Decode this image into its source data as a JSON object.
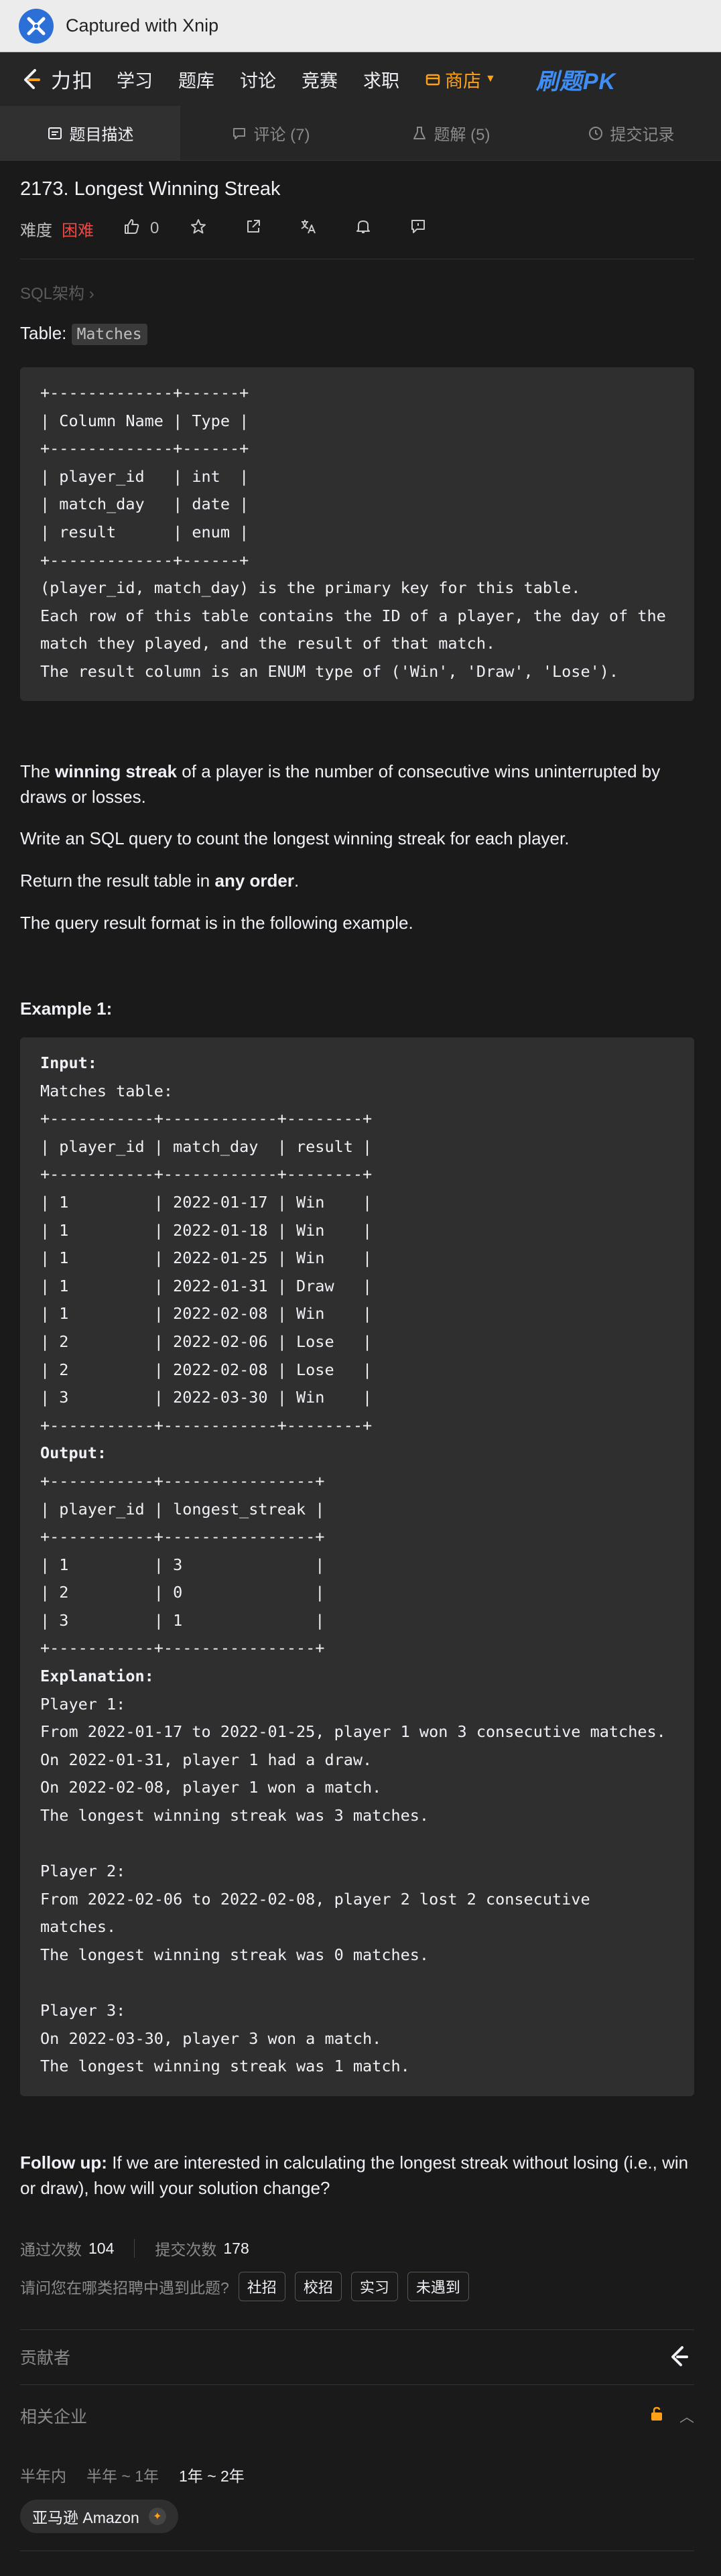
{
  "capture": {
    "title": "Captured with Xnip"
  },
  "nav": {
    "brand": "力扣",
    "items": [
      "学习",
      "题库",
      "讨论",
      "竞赛",
      "求职"
    ],
    "shop": "商店",
    "pk": "刷题PK"
  },
  "tabs": [
    {
      "label": "题目描述"
    },
    {
      "label": "评论 (7)"
    },
    {
      "label": "题解 (5)"
    },
    {
      "label": "提交记录"
    }
  ],
  "problem": {
    "title": "2173. Longest Winning Streak",
    "difficulty_label": "难度",
    "difficulty": "困难",
    "likes": "0",
    "breadcrumb": "SQL架构 ›",
    "table_label": "Table: ",
    "table_name": "Matches",
    "schema": "+-------------+------+\n| Column Name | Type |\n+-------------+------+\n| player_id   | int  |\n| match_day   | date |\n| result      | enum |\n+-------------+------+\n(player_id, match_day) is the primary key for this table.\nEach row of this table contains the ID of a player, the day of the\nmatch they played, and the result of that match.\nThe result column is an ENUM type of ('Win', 'Draw', 'Lose').",
    "desc_pre": "The ",
    "desc_bold": "winning streak",
    "desc_post": " of a player is the number of consecutive wins uninterrupted by draws or losses.",
    "query": "Write an SQL query to count the longest winning streak for each player.",
    "order_pre": "Return the result table in ",
    "order_bold": "any order",
    "order_post": ".",
    "format": "The query result format is in the following example.",
    "example_title": "Example 1:",
    "input_label": "Input:",
    "example_input": "Matches table:\n+-----------+------------+--------+\n| player_id | match_day  | result |\n+-----------+------------+--------+\n| 1         | 2022-01-17 | Win    |\n| 1         | 2022-01-18 | Win    |\n| 1         | 2022-01-25 | Win    |\n| 1         | 2022-01-31 | Draw   |\n| 1         | 2022-02-08 | Win    |\n| 2         | 2022-02-06 | Lose   |\n| 2         | 2022-02-08 | Lose   |\n| 3         | 2022-03-30 | Win    |\n+-----------+------------+--------+",
    "output_label": "Output:",
    "example_output": "+-----------+----------------+\n| player_id | longest_streak |\n+-----------+----------------+\n| 1         | 3              |\n| 2         | 0              |\n| 3         | 1              |\n+-----------+----------------+",
    "explanation_label": "Explanation:",
    "example_explanation": "Player 1:\nFrom 2022-01-17 to 2022-01-25, player 1 won 3 consecutive matches.\nOn 2022-01-31, player 1 had a draw.\nOn 2022-02-08, player 1 won a match.\nThe longest winning streak was 3 matches.\n\nPlayer 2:\nFrom 2022-02-06 to 2022-02-08, player 2 lost 2 consecutive\nmatches.\nThe longest winning streak was 0 matches.\n\nPlayer 3:\nOn 2022-03-30, player 3 won a match.\nThe longest winning streak was 1 match.",
    "followup_label": "Follow up:",
    "followup_text": " If we are interested in calculating the longest streak without losing (i.e., win or draw), how will your solution change?"
  },
  "stats": {
    "accepted_label": "通过次数",
    "accepted": "104",
    "submitted_label": "提交次数",
    "submitted": "178"
  },
  "interview": {
    "question": "请问您在哪类招聘中遇到此题?",
    "options": [
      "社招",
      "校招",
      "实习",
      "未遇到"
    ]
  },
  "contributors": {
    "label": "贡献者"
  },
  "companies": {
    "label": "相关企业",
    "periods": [
      "半年内",
      "半年 ~ 1年",
      "1年 ~ 2年"
    ],
    "selected_period": "1年 ~ 2年",
    "company": "亚马逊 Amazon"
  },
  "colors": {
    "accent": "#ffa116",
    "hard": "#ef4743",
    "pk": "#3f8ef5"
  }
}
